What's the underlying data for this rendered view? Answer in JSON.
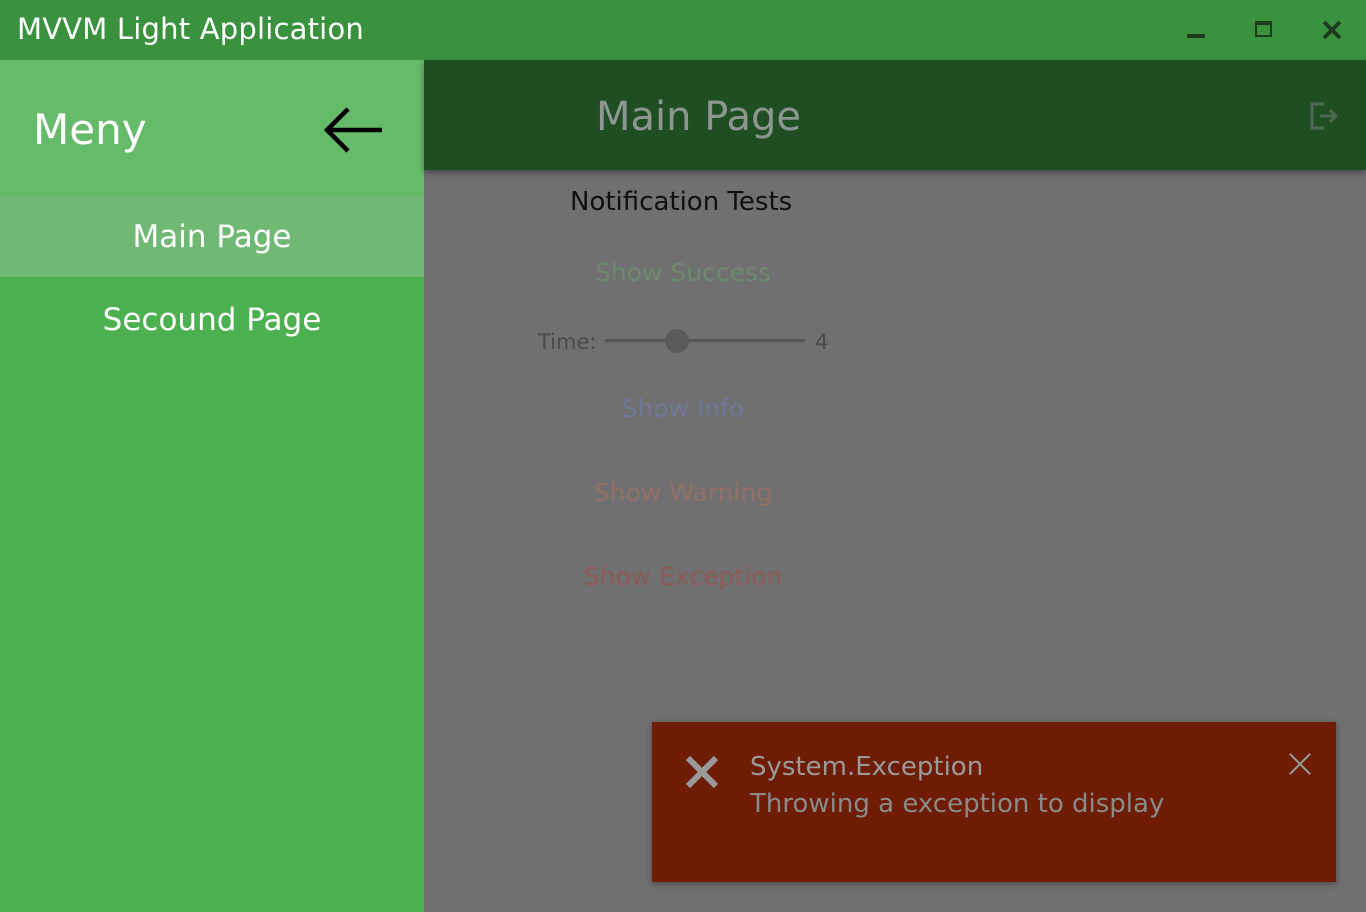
{
  "window": {
    "title": "MVVM Light Application",
    "accent": "#3a923f"
  },
  "sidebar": {
    "title": "Meny",
    "items": [
      {
        "label": "Main Page",
        "selected": true
      },
      {
        "label": "Secound Page",
        "selected": false
      }
    ]
  },
  "header": {
    "title": "Main Page"
  },
  "content": {
    "section_title": "Notification Tests",
    "buttons": {
      "success": "Show Success",
      "info": "Show Info",
      "warning": "Show Warning",
      "exception": "Show Exception"
    },
    "time": {
      "label": "Time:",
      "value": "4",
      "fraction": 0.36
    }
  },
  "toast": {
    "title": "System.Exception",
    "message": "Throwing a exception to display",
    "color": "#6e1d04"
  },
  "icons": {
    "window_controls": [
      "minimize-icon",
      "maximize-icon",
      "close-icon"
    ],
    "back": "arrow-left-icon",
    "logout": "logout-icon",
    "toast": "x-icon"
  }
}
